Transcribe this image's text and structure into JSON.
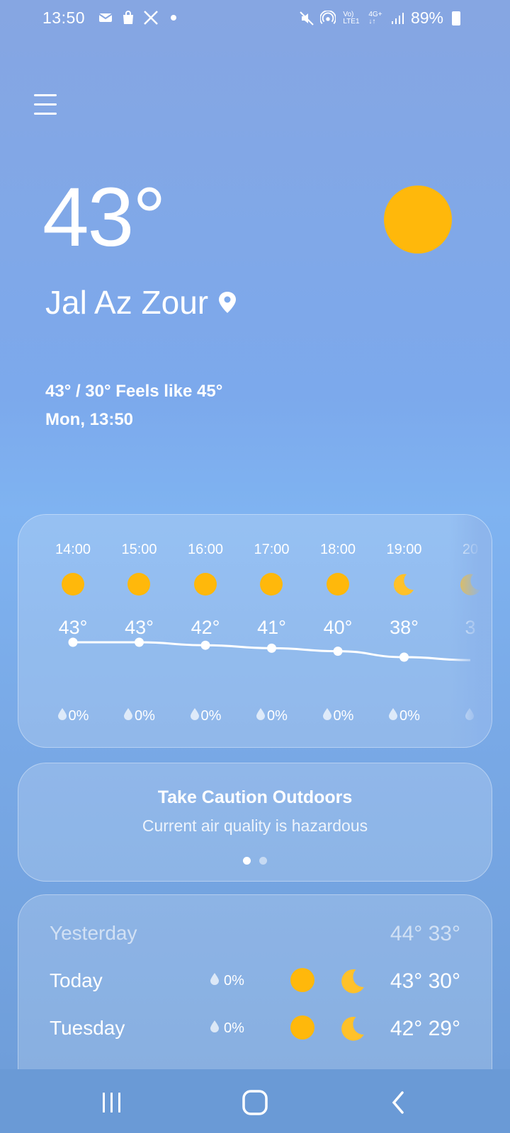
{
  "status_bar": {
    "time": "13:50",
    "battery": "89%"
  },
  "current": {
    "temperature": "43°",
    "location": "Jal Az Zour",
    "high_low_feels": "43° / 30° Feels like 45°",
    "datetime": "Mon, 13:50"
  },
  "hourly": [
    {
      "time": "14:00",
      "icon": "sun-icon",
      "temp": "43°",
      "precip": "0%",
      "value": 43
    },
    {
      "time": "15:00",
      "icon": "sun-icon",
      "temp": "43°",
      "precip": "0%",
      "value": 43
    },
    {
      "time": "16:00",
      "icon": "sun-icon",
      "temp": "42°",
      "precip": "0%",
      "value": 42
    },
    {
      "time": "17:00",
      "icon": "sun-icon",
      "temp": "41°",
      "precip": "0%",
      "value": 41
    },
    {
      "time": "18:00",
      "icon": "sun-icon",
      "temp": "40°",
      "precip": "0%",
      "value": 40
    },
    {
      "time": "19:00",
      "icon": "moon-icon",
      "temp": "38°",
      "precip": "0%",
      "value": 38
    },
    {
      "time": "20",
      "icon": "moon-icon",
      "temp": "3",
      "precip": "",
      "value": 37
    }
  ],
  "alert": {
    "title": "Take Caution Outdoors",
    "subtitle": "Current air quality is hazardous"
  },
  "daily": [
    {
      "day": "Yesterday",
      "precip": "",
      "temps": "44° 33°"
    },
    {
      "day": "Today",
      "precip": "0%",
      "temps": "43° 30°"
    },
    {
      "day": "Tuesday",
      "precip": "0%",
      "temps": "42° 29°"
    }
  ],
  "colors": {
    "sun": "#ffb80b",
    "moon": "#ffc12a"
  }
}
